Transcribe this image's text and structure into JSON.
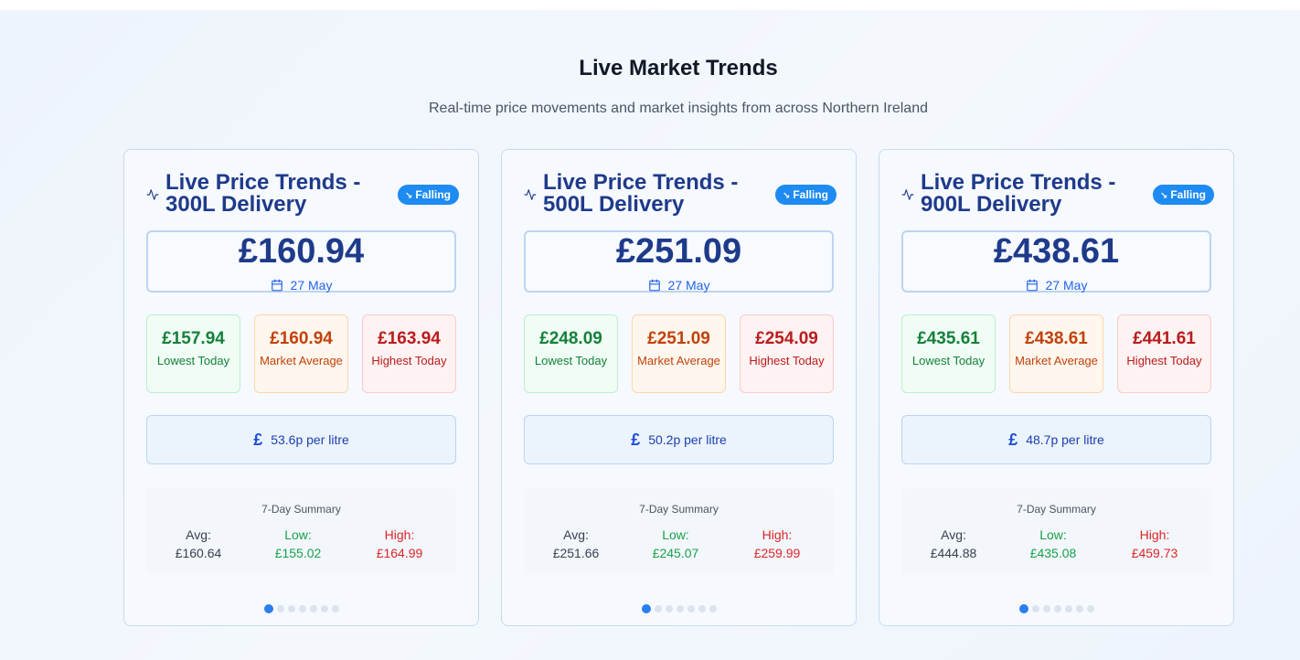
{
  "section": {
    "title": "Live Market Trends",
    "subtitle": "Real-time price movements and market insights from across Northern Ireland"
  },
  "cards": [
    {
      "title": "Live Price Trends - 300L Delivery",
      "badge": "Falling",
      "price": "£160.94",
      "date": "27 May",
      "lowest": {
        "value": "£157.94",
        "label": "Lowest Today"
      },
      "average": {
        "value": "£160.94",
        "label": "Market Average"
      },
      "highest": {
        "value": "£163.94",
        "label": "Highest Today"
      },
      "per_litre": "53.6p per litre",
      "summary": {
        "title": "7-Day Summary",
        "avg_label": "Avg:",
        "avg": "£160.64",
        "low_label": "Low:",
        "low": "£155.02",
        "high_label": "High:",
        "high": "£164.99"
      },
      "dots": 7,
      "active_dot": 1
    },
    {
      "title": "Live Price Trends - 500L Delivery",
      "badge": "Falling",
      "price": "£251.09",
      "date": "27 May",
      "lowest": {
        "value": "£248.09",
        "label": "Lowest Today"
      },
      "average": {
        "value": "£251.09",
        "label": "Market Average"
      },
      "highest": {
        "value": "£254.09",
        "label": "Highest Today"
      },
      "per_litre": "50.2p per litre",
      "summary": {
        "title": "7-Day Summary",
        "avg_label": "Avg:",
        "avg": "£251.66",
        "low_label": "Low:",
        "low": "£245.07",
        "high_label": "High:",
        "high": "£259.99"
      },
      "dots": 7,
      "active_dot": 1
    },
    {
      "title": "Live Price Trends - 900L Delivery",
      "badge": "Falling",
      "price": "£438.61",
      "date": "27 May",
      "lowest": {
        "value": "£435.61",
        "label": "Lowest Today"
      },
      "average": {
        "value": "£438.61",
        "label": "Market Average"
      },
      "highest": {
        "value": "£441.61",
        "label": "Highest Today"
      },
      "per_litre": "48.7p per litre",
      "summary": {
        "title": "7-Day Summary",
        "avg_label": "Avg:",
        "avg": "£444.88",
        "low_label": "Low:",
        "low": "£435.08",
        "high_label": "High:",
        "high": "£459.73"
      },
      "dots": 7,
      "active_dot": 1
    }
  ],
  "icons": {
    "pulse": "activity-icon",
    "badge": "trending-down-icon",
    "date": "calendar-icon",
    "litre": "pound-icon"
  },
  "colors": {
    "badge": "#1d8bf2",
    "price": "#1e3a8a",
    "low": "#15803d",
    "average": "#c2410c",
    "high": "#b91c1c",
    "dot_active": "#2b7ef1"
  }
}
